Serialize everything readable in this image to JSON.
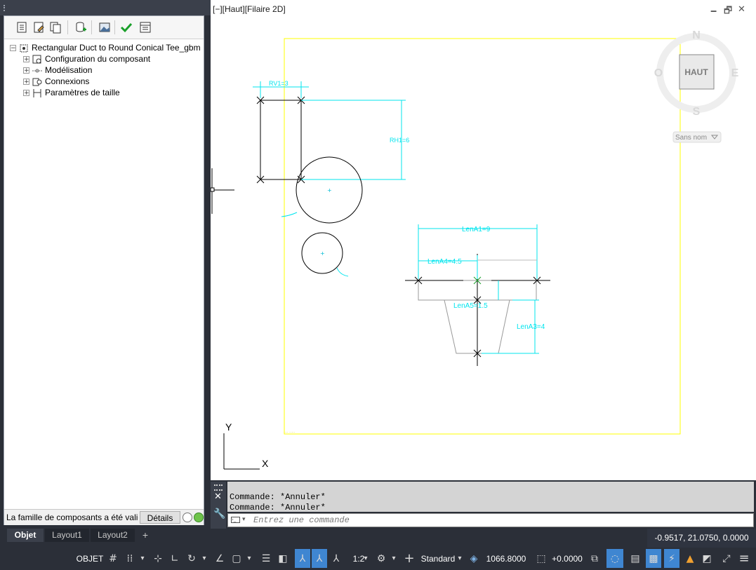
{
  "tree": {
    "root": "Rectangular Duct to Round Conical Tee_gbm",
    "items": [
      {
        "label": "Configuration du composant"
      },
      {
        "label": "Modélisation"
      },
      {
        "label": "Connexions"
      },
      {
        "label": "Paramètres de taille"
      }
    ]
  },
  "panel_status": {
    "message": "La famille de composants a été validée",
    "details_label": "Détails"
  },
  "viewport": {
    "label": "[−][Haut][Filaire 2D]",
    "viewcube": {
      "face": "HAUT",
      "north": "N",
      "south": "S",
      "east": "E",
      "west": "O",
      "wcs": "Sans nom"
    },
    "ucs": {
      "x": "X",
      "y": "Y"
    }
  },
  "dimensions": {
    "rv1": "RV1=3",
    "rh1": "RH1=6",
    "lena1": "LenA1=9",
    "lena4": "LenA4=4.5",
    "lena5": "LenA5=1.5",
    "lena3": "LenA3=4"
  },
  "command": {
    "history": [
      "Commande: *Annuler*",
      "Commande: *Annuler*"
    ],
    "placeholder": "Entrez une commande"
  },
  "layout_tabs": [
    {
      "label": "Objet",
      "active": true
    },
    {
      "label": "Layout1",
      "active": false
    },
    {
      "label": "Layout2",
      "active": false
    }
  ],
  "add_tab": "+",
  "coordinates": "-0.9517, 21.0750, 0.0000",
  "statusbar": {
    "objet": "OBJET",
    "scale": "1:2",
    "style": "Standard",
    "elevation": "1066.8000",
    "offset": "+0.0000"
  },
  "colors": {
    "dimension": "#00e5ee",
    "boundary": "#ffff00",
    "ui_dark": "#2b2f38",
    "active_toggle": "#3f86d1"
  }
}
